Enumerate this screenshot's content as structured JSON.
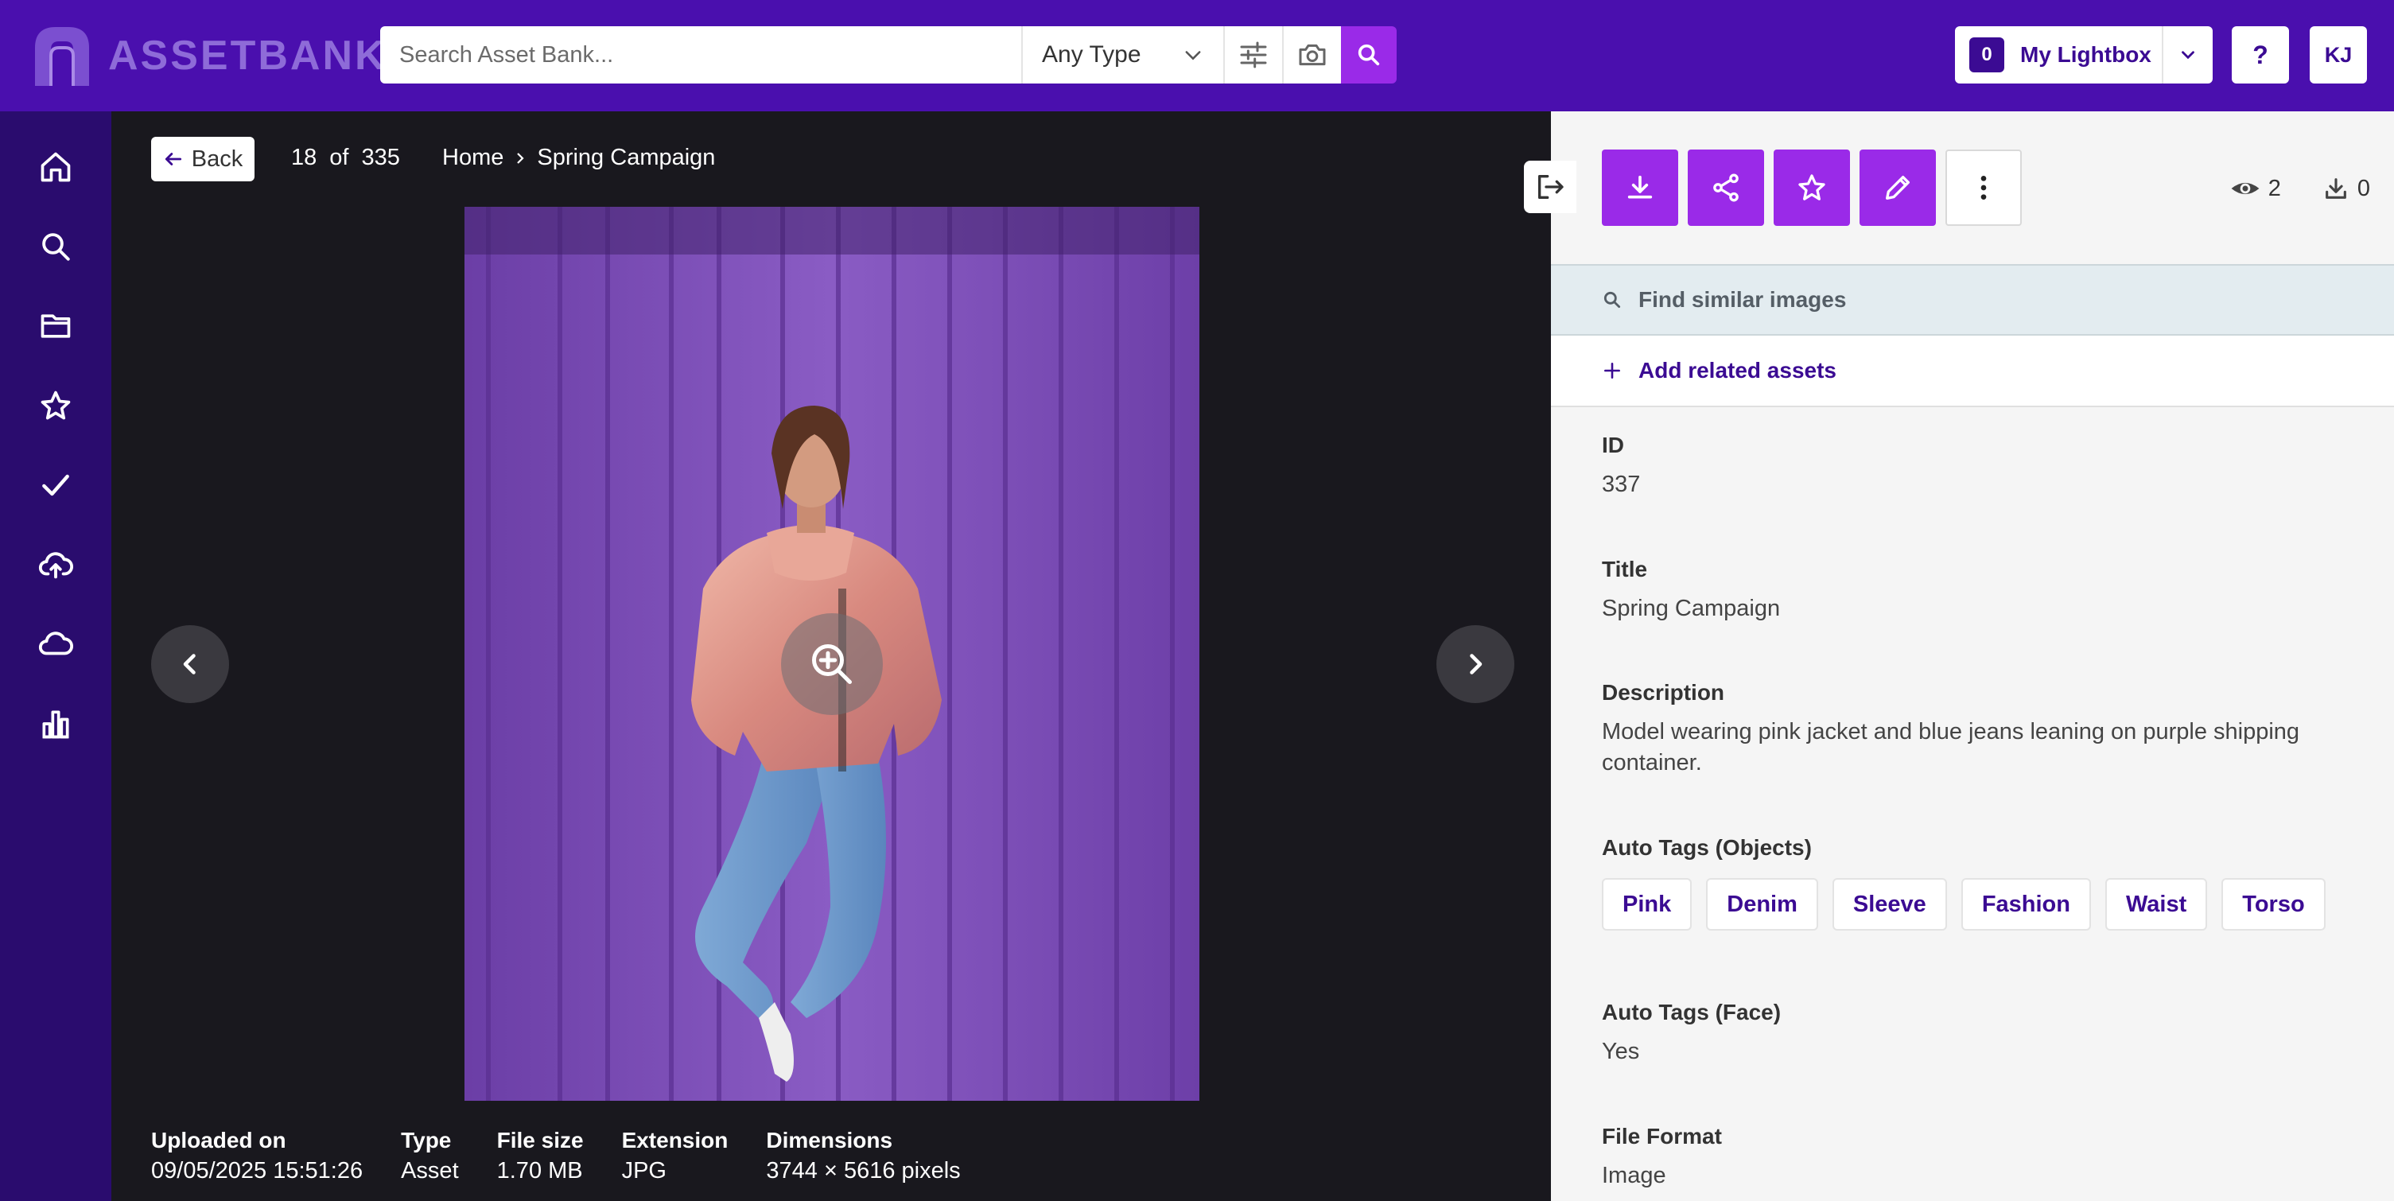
{
  "brand": {
    "name": "ASSETBANK",
    "logo_icon": "assetbank-logo-icon"
  },
  "search": {
    "placeholder": "Search Asset Bank...",
    "type_value": "Any Type"
  },
  "lightbox": {
    "count": "0",
    "label": "My Lightbox"
  },
  "help_label": "?",
  "user_initials": "KJ",
  "sidebar": {
    "items": [
      {
        "name": "home",
        "icon": "home-icon"
      },
      {
        "name": "search",
        "icon": "search-icon"
      },
      {
        "name": "folders",
        "icon": "folder-icon"
      },
      {
        "name": "favorites",
        "icon": "star-icon"
      },
      {
        "name": "approvals",
        "icon": "check-icon"
      },
      {
        "name": "upload",
        "icon": "cloud-upload-icon"
      },
      {
        "name": "cloud",
        "icon": "cloud-icon"
      },
      {
        "name": "reports",
        "icon": "bar-chart-icon"
      }
    ]
  },
  "viewer": {
    "back_label": "Back",
    "position": "18",
    "of_label": "of",
    "total": "335",
    "breadcrumb": [
      "Home",
      "Spring Campaign"
    ],
    "image_description": "Model wearing pink jacket and blue jeans leaning on purple shipping container",
    "meta": [
      {
        "label": "Uploaded on",
        "value": "09/05/2025 15:51:26"
      },
      {
        "label": "Type",
        "value": "Asset"
      },
      {
        "label": "File size",
        "value": "1.70 MB"
      },
      {
        "label": "Extension",
        "value": "JPG"
      },
      {
        "label": "Dimensions",
        "value": "3744 × 5616 pixels"
      }
    ]
  },
  "panel": {
    "views": "2",
    "downloads": "0",
    "find_similar_label": "Find similar images",
    "add_related_label": "Add related assets",
    "fields": {
      "id": {
        "label": "ID",
        "value": "337"
      },
      "title": {
        "label": "Title",
        "value": "Spring Campaign"
      },
      "description": {
        "label": "Description",
        "value": "Model wearing pink jacket and blue jeans leaning on purple shipping container."
      },
      "auto_tags_objects": {
        "label": "Auto Tags (Objects)",
        "tags": [
          "Pink",
          "Denim",
          "Sleeve",
          "Fashion",
          "Waist",
          "Torso"
        ]
      },
      "auto_tags_face": {
        "label": "Auto Tags (Face)",
        "value": "Yes"
      },
      "file_format": {
        "label": "File Format",
        "value": "Image"
      }
    }
  },
  "colors": {
    "topbar": "#4a0fae",
    "sidebar": "#2a0c6e",
    "accent": "#9a2ae8",
    "brand_text": "#3b0b93",
    "viewer_bg": "#19181e"
  }
}
